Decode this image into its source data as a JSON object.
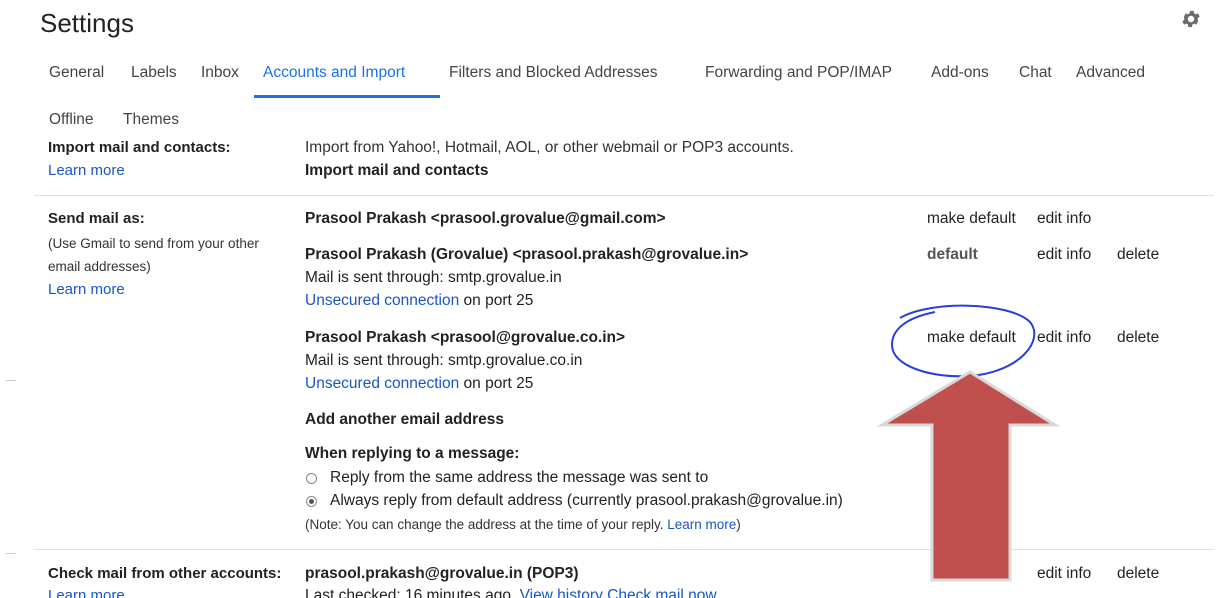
{
  "page_title": "Settings",
  "tabs": [
    {
      "label": "General"
    },
    {
      "label": "Labels"
    },
    {
      "label": "Inbox"
    },
    {
      "label": "Accounts and Import"
    },
    {
      "label": "Filters and Blocked Addresses"
    },
    {
      "label": "Forwarding and POP/IMAP"
    },
    {
      "label": "Add-ons"
    },
    {
      "label": "Chat"
    },
    {
      "label": "Advanced"
    },
    {
      "label": "Offline"
    },
    {
      "label": "Themes"
    }
  ],
  "active_tab": "Accounts and Import",
  "import": {
    "label": "Import mail and contacts:",
    "learn_more": "Learn more",
    "description": "Import from Yahoo!, Hotmail, AOL, or other webmail or POP3 accounts.",
    "action": "Import mail and contacts"
  },
  "send_mail": {
    "label": "Send mail as:",
    "help_line1": "(Use Gmail to send from your other",
    "help_line2": "email addresses)",
    "learn_more": "Learn more",
    "accounts": [
      {
        "name": "Prasool Prakash <prasool.grovalue@gmail.com>",
        "status": "make default",
        "edit": "edit info"
      },
      {
        "name": "Prasool Prakash (Grovalue) <prasool.prakash@grovalue.in>",
        "smtp": "Mail is sent through: smtp.grovalue.in",
        "security": "Unsecured connection",
        "port": " on port 25",
        "status": "default",
        "edit": "edit info",
        "delete": "delete"
      },
      {
        "name": "Prasool Prakash <prasool@grovalue.co.in>",
        "smtp": "Mail is sent through: smtp.grovalue.co.in",
        "security": "Unsecured connection",
        "port": " on port 25",
        "status": "make default",
        "edit": "edit info",
        "delete": "delete"
      }
    ],
    "add_another": "Add another email address",
    "reply_heading": "When replying to a message:",
    "reply_option_1": "Reply from the same address the message was sent to",
    "reply_option_2": "Always reply from default address (currently prasool.prakash@grovalue.in)",
    "reply_selected": 2,
    "note": "(Note: You can change the address at the time of your reply.",
    "note_link": "Learn more",
    "note_end": ")"
  },
  "check_mail": {
    "label": "Check mail from other accounts:",
    "account": "prasool.prakash@grovalue.in (POP3)",
    "edit": "edit info",
    "delete": "delete",
    "learn_more": "Learn more",
    "last_checked": "Last checked: 16 minutes ago.",
    "view_history": "View history",
    "check_now": "Check mail now"
  },
  "colors": {
    "link": "#1a56c4",
    "active_tab": "#1a73e8",
    "annotation_circle": "#2b3fd8",
    "annotation_arrow": "#c0504d"
  },
  "icons": {
    "settings": "gear-icon",
    "radio_unchecked": "radio-unchecked",
    "radio_checked": "radio-checked"
  }
}
